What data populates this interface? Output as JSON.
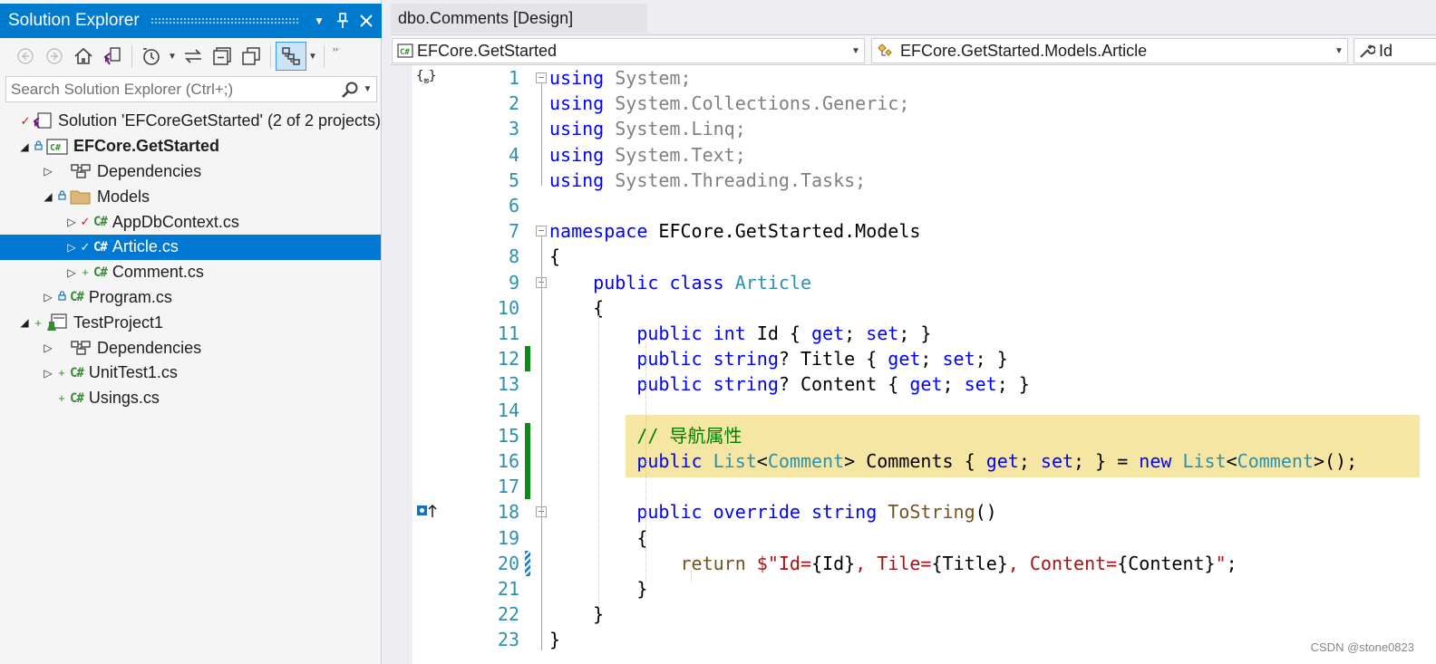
{
  "solution_explorer": {
    "title": "Solution Explorer",
    "search_placeholder": "Search Solution Explorer (Ctrl+;)",
    "toolbar_icons": [
      "back-icon",
      "forward-icon",
      "home-icon",
      "vs-switch-icon",
      "history-icon",
      "sync-icon",
      "collapse-icon",
      "copy-icon",
      "show-all-files-icon"
    ],
    "tree": [
      {
        "label": "Solution 'EFCoreGetStarted' (2 of 2 projects)",
        "icon": "solution-icon",
        "status": "check",
        "level": 0,
        "expander": ""
      },
      {
        "label": "EFCore.GetStarted",
        "icon": "csproj-icon",
        "status": "lock",
        "level": 1,
        "expander": "open",
        "bold": true
      },
      {
        "label": "Dependencies",
        "icon": "dependencies-icon",
        "status": "",
        "level": 2,
        "expander": "closed"
      },
      {
        "label": "Models",
        "icon": "folder-icon",
        "status": "lock",
        "level": 2,
        "expander": "open"
      },
      {
        "label": "AppDbContext.cs",
        "icon": "csharp-file-icon",
        "status": "check",
        "level": 3,
        "expander": "closed"
      },
      {
        "label": "Article.cs",
        "icon": "csharp-file-icon",
        "status": "check",
        "level": 3,
        "expander": "closed",
        "selected": true
      },
      {
        "label": "Comment.cs",
        "icon": "csharp-file-icon",
        "status": "plus",
        "level": 3,
        "expander": "closed"
      },
      {
        "label": "Program.cs",
        "icon": "csharp-file-icon",
        "status": "lock",
        "level": 2,
        "expander": "closed"
      },
      {
        "label": "TestProject1",
        "icon": "test-project-icon",
        "status": "plus",
        "level": 1,
        "expander": "open"
      },
      {
        "label": "Dependencies",
        "icon": "dependencies-icon",
        "status": "",
        "level": 2,
        "expander": "closed"
      },
      {
        "label": "UnitTest1.cs",
        "icon": "csharp-file-icon",
        "status": "plus",
        "level": 2,
        "expander": "closed"
      },
      {
        "label": "Usings.cs",
        "icon": "csharp-file-icon",
        "status": "plus",
        "level": 2,
        "expander": ""
      }
    ]
  },
  "editor": {
    "tab_title": "dbo.Comments [Design]",
    "nav": {
      "project": "EFCore.GetStarted",
      "type": "EFCore.GetStarted.Models.Article",
      "member": "Id"
    },
    "line_numbers": [
      "1",
      "2",
      "3",
      "4",
      "5",
      "6",
      "7",
      "8",
      "9",
      "10",
      "11",
      "12",
      "13",
      "14",
      "15",
      "16",
      "17",
      "18",
      "19",
      "20",
      "21",
      "22",
      "23"
    ],
    "code_lines": [
      "using System;",
      "using System.Collections.Generic;",
      "using System.Linq;",
      "using System.Text;",
      "using System.Threading.Tasks;",
      "",
      "namespace EFCore.GetStarted.Models",
      "{",
      "    public class Article",
      "    {",
      "        public int Id { get; set; }",
      "        public string? Title { get; set; }",
      "        public string? Content { get; set; }",
      "",
      "        // 导航属性",
      "        public List<Comment> Comments { get; set; } = new List<Comment>();",
      "",
      "        public override string ToString()",
      "        {",
      "            return $\"Id={Id}, Tile={Title}, Content={Content}\";",
      "        }",
      "    }",
      "}"
    ]
  },
  "watermark": "CSDN @stone0823"
}
